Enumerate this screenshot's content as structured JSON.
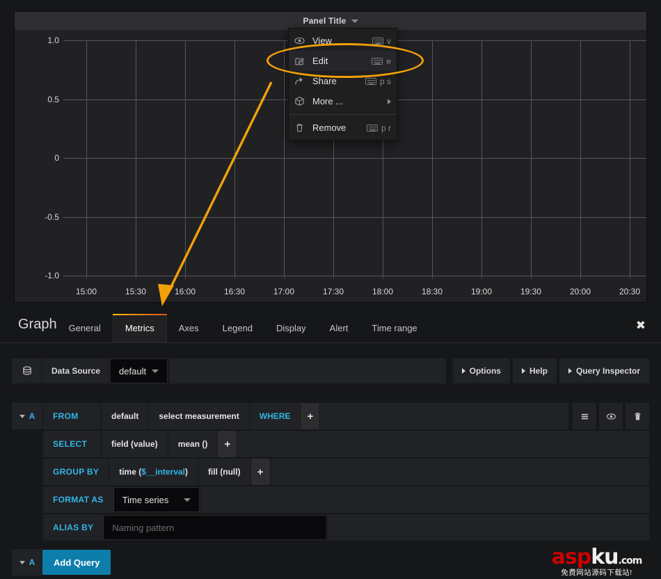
{
  "panel": {
    "title": "Panel Title",
    "caret_icon": "chevron-down-icon",
    "menu": {
      "items": [
        {
          "label": "View",
          "icon": "eye-icon",
          "shortcut": "v",
          "kbd": true,
          "submenu": false
        },
        {
          "label": "Edit",
          "icon": "pencil-square-icon",
          "shortcut": "e",
          "kbd": true,
          "submenu": false
        },
        {
          "label": "Share",
          "icon": "share-arrow-icon",
          "shortcut": "p s",
          "kbd": true,
          "submenu": false
        },
        {
          "label": "More ...",
          "icon": "cube-icon",
          "shortcut": "",
          "kbd": false,
          "submenu": true
        },
        {
          "label": "Remove",
          "icon": "trash-icon",
          "shortcut": "p r",
          "kbd": true,
          "submenu": false
        }
      ],
      "highlighted_item": "Edit",
      "highlight_color": "#f2a10a"
    }
  },
  "chart_data": {
    "type": "line",
    "title": "Panel Title",
    "series": [],
    "x": [
      "15:00",
      "15:30",
      "16:00",
      "16:30",
      "17:00",
      "17:30",
      "18:00",
      "18:30",
      "19:00",
      "19:30",
      "20:00",
      "20:30"
    ],
    "xtick_labels": [
      "15:00",
      "15:30",
      "16:00",
      "16:30",
      "17:00",
      "17:30",
      "18:00",
      "18:30",
      "19:00",
      "19:30",
      "20:00",
      "20:30"
    ],
    "ytick_labels": [
      "1.0",
      "0.5",
      "0",
      "-0.5",
      "-1.0"
    ],
    "yticks": [
      1.0,
      0.5,
      0,
      -0.5,
      -1.0
    ],
    "ylim": [
      -1.0,
      1.0
    ],
    "xlabel": "",
    "ylabel": "",
    "grid": true,
    "legend": false,
    "no_data": true
  },
  "editor": {
    "type_label": "Graph",
    "tabs": [
      {
        "label": "General",
        "active": false
      },
      {
        "label": "Metrics",
        "active": true
      },
      {
        "label": "Axes",
        "active": false
      },
      {
        "label": "Legend",
        "active": false
      },
      {
        "label": "Display",
        "active": false
      },
      {
        "label": "Alert",
        "active": false
      },
      {
        "label": "Time range",
        "active": false
      }
    ],
    "close_icon": "close-icon",
    "close_glyph": "✖",
    "accent_colors": {
      "tab_underline_start": "#f5c20a",
      "tab_underline_end": "#e0531f",
      "link_blue": "#33b5e5",
      "button_blue": "#0d7eab"
    }
  },
  "datasource": {
    "icon": "database-icon",
    "label": "Data Source",
    "value": "default",
    "buttons": [
      {
        "label": "Options"
      },
      {
        "label": "Help"
      },
      {
        "label": "Query Inspector"
      }
    ]
  },
  "query": {
    "ref_id": "A",
    "rows": [
      {
        "key": "FROM",
        "values": [
          {
            "text": "default",
            "style": "plain"
          },
          {
            "text": "select measurement",
            "style": "plain"
          },
          {
            "text": "WHERE",
            "style": "blue"
          }
        ],
        "plus": "+"
      },
      {
        "key": "SELECT",
        "values": [
          {
            "text": "field (value)",
            "style": "plain"
          },
          {
            "text": "mean ()",
            "style": "plain"
          }
        ],
        "plus": "+"
      },
      {
        "key": "GROUP BY",
        "values": [
          {
            "text": "time ($__interval)",
            "style": "mixed"
          },
          {
            "text": "fill (null)",
            "style": "plain"
          }
        ],
        "plus": "+"
      }
    ],
    "group_by_parts": {
      "prefix": "time (",
      "var": "$__interval",
      "suffix": ")"
    },
    "format_as": {
      "key": "FORMAT AS",
      "value": "Time series"
    },
    "alias_by": {
      "key": "ALIAS BY",
      "placeholder": "Naming pattern",
      "value": ""
    },
    "actions": [
      {
        "icon": "hamburger-icon",
        "name": "toggle-text-edit"
      },
      {
        "icon": "eye-icon",
        "name": "toggle-hide-query"
      },
      {
        "icon": "trash-icon",
        "name": "remove-query"
      }
    ],
    "add_query_label": "Add Query",
    "add_query_ref": "A"
  },
  "watermark": {
    "part_red": "asp",
    "part_white": "ku",
    "domain": ".com",
    "subtitle": "免费网站源码下载站!"
  }
}
